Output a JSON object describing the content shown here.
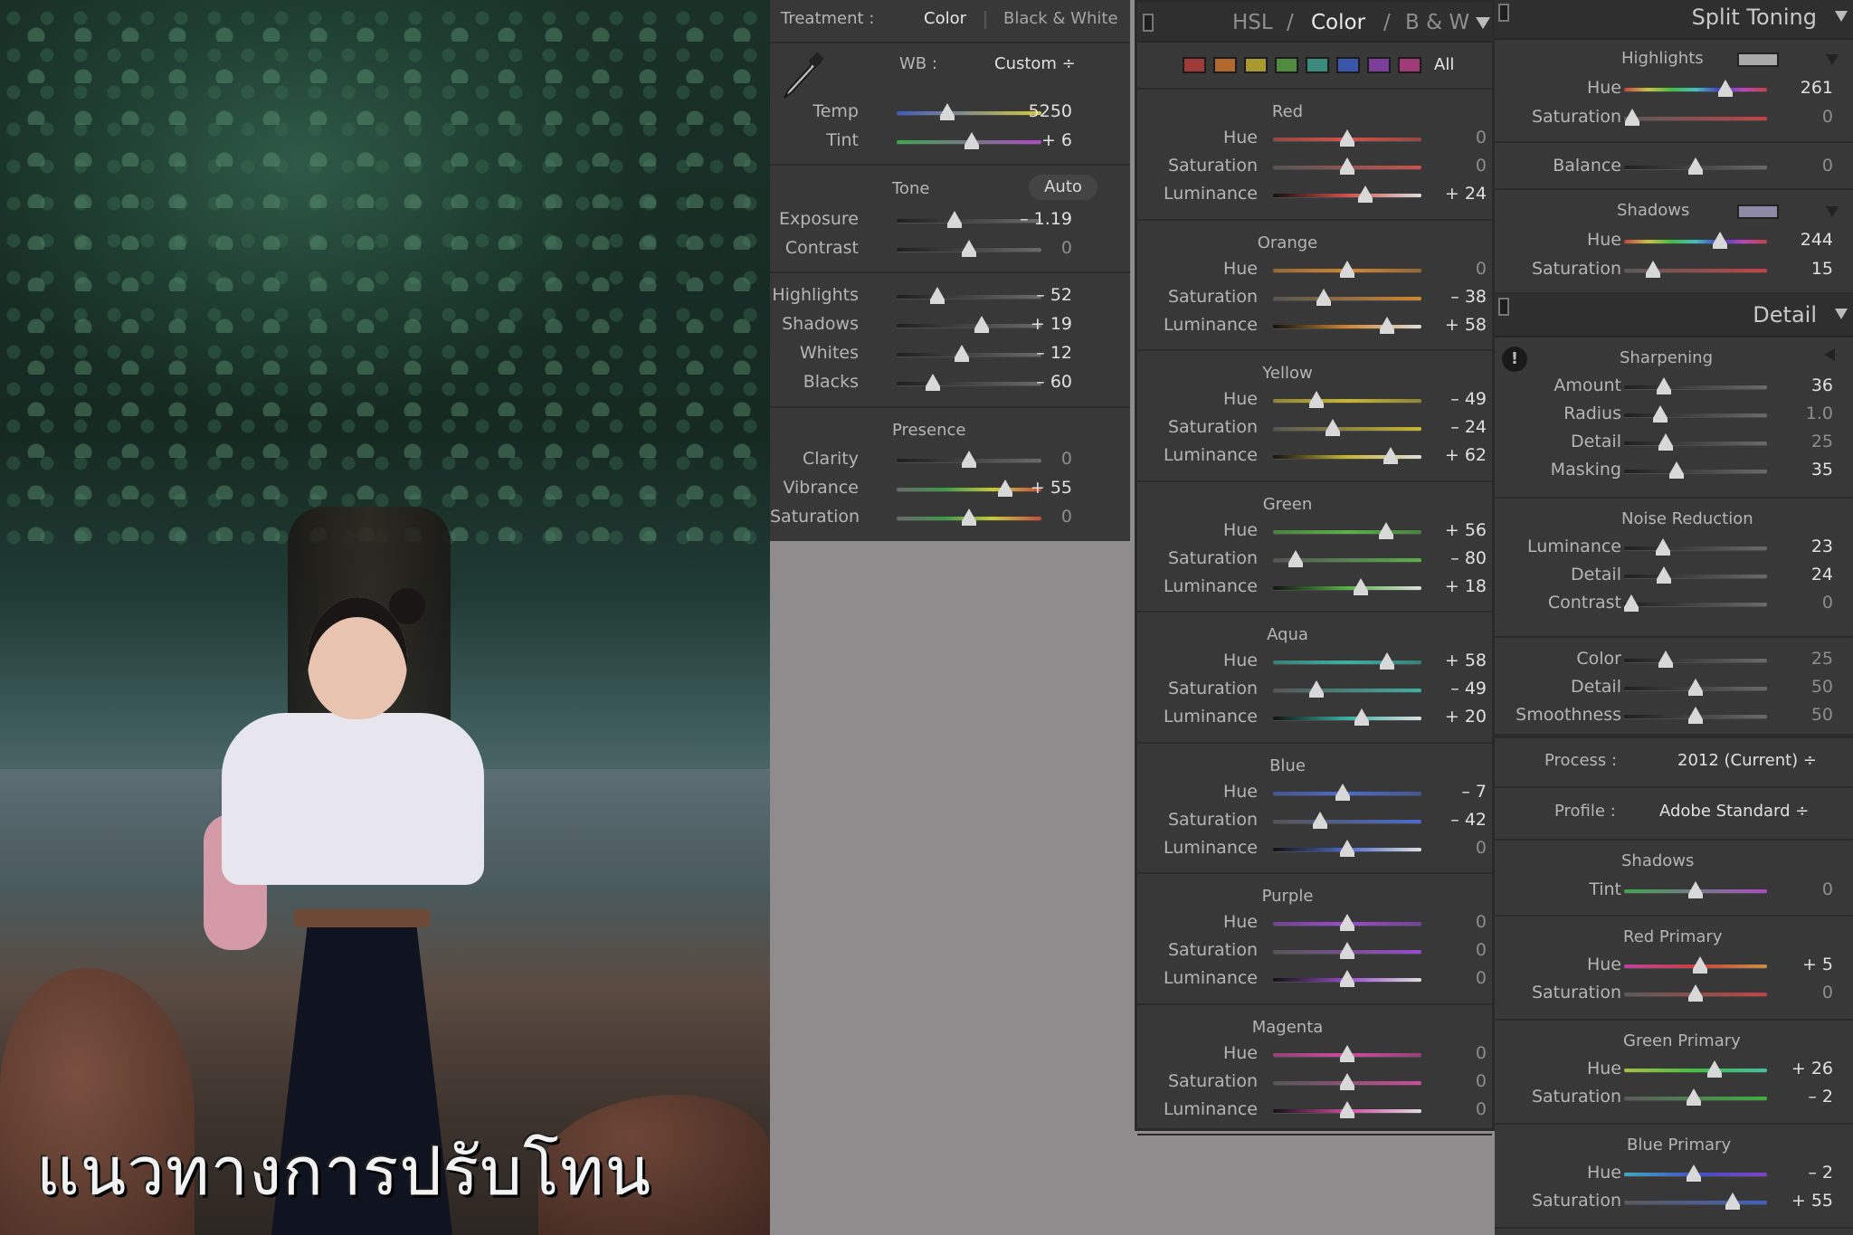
{
  "caption": "แนวทางการปรับโทน",
  "basic": {
    "treatment_label": "Treatment :",
    "color_option": "Color",
    "bw_option": "Black & White",
    "wb_label": "WB :",
    "wb_value": "Custom ÷",
    "tone_title": "Tone",
    "auto_label": "Auto",
    "presence_title": "Presence",
    "groups": [
      {
        "rows": [
          {
            "label": "Temp",
            "value": "5250",
            "pos": 0.35,
            "track": "temp"
          },
          {
            "label": "Tint",
            "value": "+ 6",
            "pos": 0.52,
            "track": "tint"
          }
        ]
      },
      {
        "rows": [
          {
            "label": "Exposure",
            "value": "– 1.19",
            "pos": 0.4,
            "track": "gray"
          },
          {
            "label": "Contrast",
            "value": "0",
            "pos": 0.5,
            "track": "gray",
            "dim": true
          }
        ]
      },
      {
        "rows": [
          {
            "label": "Highlights",
            "value": "– 52",
            "pos": 0.28,
            "track": "gray"
          },
          {
            "label": "Shadows",
            "value": "+ 19",
            "pos": 0.59,
            "track": "gray"
          },
          {
            "label": "Whites",
            "value": "– 12",
            "pos": 0.45,
            "track": "gray"
          },
          {
            "label": "Blacks",
            "value": "– 60",
            "pos": 0.25,
            "track": "gray"
          }
        ]
      },
      {
        "rows": [
          {
            "label": "Clarity",
            "value": "0",
            "pos": 0.5,
            "track": "gray",
            "dim": true
          },
          {
            "label": "Vibrance",
            "value": "+ 55",
            "pos": 0.75,
            "track": "vib"
          },
          {
            "label": "Saturation",
            "value": "0",
            "pos": 0.5,
            "track": "vib",
            "dim": true
          }
        ]
      }
    ]
  },
  "hsl": {
    "tab_hsl": "HSL",
    "sep": "/",
    "tab_color": "Color",
    "tab_bw": "B & W",
    "all_label": "All",
    "swatches": [
      "#a03a3a",
      "#b0682e",
      "#a89a2c",
      "#4f8a3e",
      "#3b8b7c",
      "#3a56a8",
      "#7c3e9a",
      "#a03a78"
    ],
    "colors": [
      {
        "name": "Red",
        "c": "#d0504a",
        "hue": {
          "value": "0",
          "pos": 0.5,
          "dim": true
        },
        "sat": {
          "value": "0",
          "pos": 0.5,
          "dim": true
        },
        "lum": {
          "value": "+ 24",
          "pos": 0.62
        }
      },
      {
        "name": "Orange",
        "c": "#d0862e",
        "hue": {
          "value": "0",
          "pos": 0.5,
          "dim": true
        },
        "sat": {
          "value": "– 38",
          "pos": 0.34
        },
        "lum": {
          "value": "+ 58",
          "pos": 0.77
        }
      },
      {
        "name": "Yellow",
        "c": "#c8b62e",
        "hue": {
          "value": "– 49",
          "pos": 0.29
        },
        "sat": {
          "value": "– 24",
          "pos": 0.4
        },
        "lum": {
          "value": "+ 62",
          "pos": 0.79
        }
      },
      {
        "name": "Green",
        "c": "#58b048",
        "hue": {
          "value": "+ 56",
          "pos": 0.76
        },
        "sat": {
          "value": "– 80",
          "pos": 0.15
        },
        "lum": {
          "value": "+ 18",
          "pos": 0.59
        }
      },
      {
        "name": "Aqua",
        "c": "#3ab0a4",
        "hue": {
          "value": "+ 58",
          "pos": 0.77
        },
        "sat": {
          "value": "– 49",
          "pos": 0.29
        },
        "lum": {
          "value": "+ 20",
          "pos": 0.6
        }
      },
      {
        "name": "Blue",
        "c": "#4a6ad0",
        "hue": {
          "value": "– 7",
          "pos": 0.47
        },
        "sat": {
          "value": "– 42",
          "pos": 0.32
        },
        "lum": {
          "value": "0",
          "pos": 0.5,
          "dim": true
        }
      },
      {
        "name": "Purple",
        "c": "#9a4ad0",
        "hue": {
          "value": "0",
          "pos": 0.5,
          "dim": true
        },
        "sat": {
          "value": "0",
          "pos": 0.5,
          "dim": true
        },
        "lum": {
          "value": "0",
          "pos": 0.5,
          "dim": true
        }
      },
      {
        "name": "Magenta",
        "c": "#d04aa0",
        "hue": {
          "value": "0",
          "pos": 0.5,
          "dim": true
        },
        "sat": {
          "value": "0",
          "pos": 0.5,
          "dim": true
        },
        "lum": {
          "value": "0",
          "pos": 0.5,
          "dim": true
        }
      }
    ],
    "labels": {
      "hue": "Hue",
      "sat": "Saturation",
      "lum": "Luminance"
    }
  },
  "split": {
    "title": "Split Toning",
    "highlights": "Highlights",
    "shadows": "Shadows",
    "hl_swatch": "#a9a9a9",
    "sh_swatch": "#8e8aa6",
    "hl_hue": {
      "label": "Hue",
      "value": "261",
      "pos": 0.71
    },
    "hl_sat": {
      "label": "Saturation",
      "value": "0",
      "pos": 0.06,
      "dim": true
    },
    "balance": {
      "label": "Balance",
      "value": "0",
      "pos": 0.5,
      "dim": true
    },
    "sh_hue": {
      "label": "Hue",
      "value": "244",
      "pos": 0.67
    },
    "sh_sat": {
      "label": "Saturation",
      "value": "15",
      "pos": 0.2
    }
  },
  "detail": {
    "title": "Detail",
    "sharpening": "Sharpening",
    "noise": "Noise Reduction",
    "amount": {
      "label": "Amount",
      "value": "36",
      "pos": 0.28
    },
    "radius": {
      "label": "Radius",
      "value": "1.0",
      "pos": 0.25,
      "dim": true
    },
    "det": {
      "label": "Detail",
      "value": "25",
      "pos": 0.29,
      "dim": true
    },
    "masking": {
      "label": "Masking",
      "value": "35",
      "pos": 0.37
    },
    "lum": {
      "label": "Luminance",
      "value": "23",
      "pos": 0.27
    },
    "ldet": {
      "label": "Detail",
      "value": "24",
      "pos": 0.28
    },
    "lcon": {
      "label": "Contrast",
      "value": "0",
      "pos": 0.05,
      "dim": true
    },
    "color": {
      "label": "Color",
      "value": "25",
      "pos": 0.29,
      "dim": true
    },
    "cdet": {
      "label": "Detail",
      "value": "50",
      "pos": 0.5,
      "dim": true
    },
    "smooth": {
      "label": "Smoothness",
      "value": "50",
      "pos": 0.5,
      "dim": true
    }
  },
  "calib": {
    "process_label": "Process :",
    "process_value": "2012 (Current) ÷",
    "profile_label": "Profile :",
    "profile_value": "Adobe Standard ÷",
    "shadows": "Shadows",
    "red": "Red Primary",
    "green": "Green Primary",
    "blue": "Blue Primary",
    "tint": {
      "label": "Tint",
      "value": "0",
      "pos": 0.5,
      "dim": true
    },
    "r_hue": {
      "label": "Hue",
      "value": "+ 5",
      "pos": 0.53
    },
    "r_sat": {
      "label": "Saturation",
      "value": "0",
      "pos": 0.5,
      "dim": true
    },
    "g_hue": {
      "label": "Hue",
      "value": "+ 26",
      "pos": 0.63
    },
    "g_sat": {
      "label": "Saturation",
      "value": "– 2",
      "pos": 0.49
    },
    "b_hue": {
      "label": "Hue",
      "value": "– 2",
      "pos": 0.49
    },
    "b_sat": {
      "label": "Saturation",
      "value": "+ 55",
      "pos": 0.76
    }
  }
}
